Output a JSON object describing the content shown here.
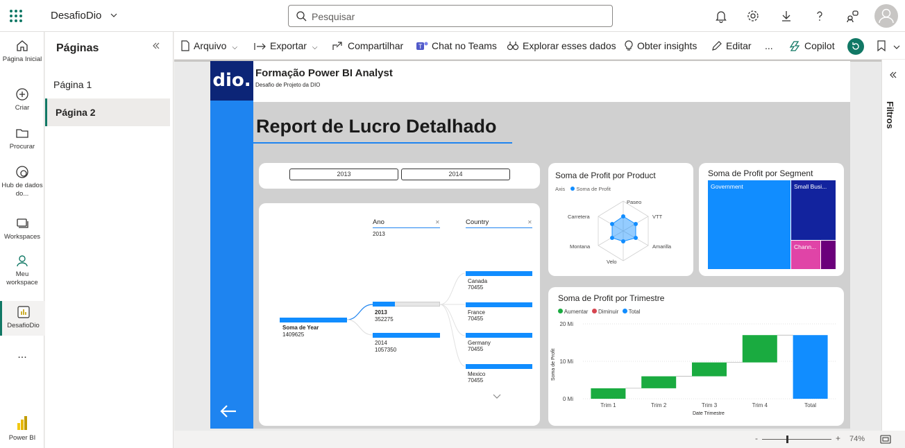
{
  "app": {
    "workspace_title": "DesafioDio",
    "search_placeholder": "Pesquisar"
  },
  "rail": {
    "home": "Página Inicial",
    "create": "Criar",
    "browse": "Procurar",
    "datahub": "Hub de dados do...",
    "workspaces": "Workspaces",
    "myworkspace": "Meu workspace",
    "current": "DesafioDio",
    "more": "...",
    "powerbi": "Power BI"
  },
  "pages": {
    "title": "Páginas",
    "items": [
      "Página 1",
      "Página 2"
    ],
    "selected": "Página 2"
  },
  "toolbar": {
    "file": "Arquivo",
    "export": "Exportar",
    "share": "Compartilhar",
    "teams": "Chat no Teams",
    "explore": "Explorar esses dados",
    "insights": "Obter insights",
    "edit": "Editar",
    "more": "...",
    "copilot": "Copilot"
  },
  "report": {
    "header_title": "Formação Power BI Analyst",
    "header_subtitle": "Desafio de Projeto da DIO",
    "logo_text": "dio.",
    "main_title": "Report de Lucro Detalhado",
    "year_slicer": [
      "2013",
      "2014"
    ],
    "decomp": {
      "col1_label": "Ano",
      "col1_value": "2013",
      "col2_label": "Country",
      "root_label": "Soma de Year",
      "root_value": "1409625",
      "years": [
        {
          "label": "2013",
          "value": "352275"
        },
        {
          "label": "2014",
          "value": "1057350"
        }
      ],
      "countries": [
        {
          "label": "Canada",
          "value": "70455"
        },
        {
          "label": "France",
          "value": "70455"
        },
        {
          "label": "Germany",
          "value": "70455"
        },
        {
          "label": "Mexico",
          "value": "70455"
        }
      ]
    }
  },
  "radar": {
    "title": "Soma de Profit por Product",
    "legend_axis": "Axis",
    "legend_series": "Soma de Profit",
    "axes": [
      "Paseo",
      "VTT",
      "Amarilla",
      "Velo",
      "Montana",
      "Carretera"
    ]
  },
  "treemap": {
    "title": "Soma de Profit por Segment",
    "segments": [
      "Government",
      "Small Busi...",
      "Chann..."
    ]
  },
  "chart_data": {
    "type": "bar",
    "subtype": "waterfall",
    "title": "Soma de Profit por Trimestre",
    "xlabel": "Date Trimestre",
    "ylabel": "Soma de Profit",
    "categories": [
      "Trim 1",
      "Trim 2",
      "Trim 3",
      "Trim 4",
      "Total"
    ],
    "values": [
      2.8,
      3.2,
      3.7,
      7.3,
      17.0
    ],
    "legend": [
      "Aumentar",
      "Diminuir",
      "Total"
    ],
    "colors": {
      "increase": "#1aab40",
      "decrease": "#d64550",
      "total": "#118dff"
    },
    "yticks": [
      "0 Mi",
      "10 Mi",
      "20 Mi"
    ],
    "ylim": [
      0,
      20
    ]
  },
  "status": {
    "zoom": "74%"
  }
}
